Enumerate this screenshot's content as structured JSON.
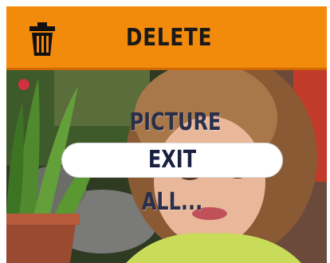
{
  "header": {
    "title": "DELETE",
    "icon": "trash-icon",
    "background_color": "#f28a0c"
  },
  "menu": {
    "items": [
      {
        "label": "PICTURE",
        "selected": false
      },
      {
        "label": "EXIT",
        "selected": true
      },
      {
        "label": "ALL...",
        "selected": false
      }
    ],
    "highlight_color": "#ffffff"
  }
}
